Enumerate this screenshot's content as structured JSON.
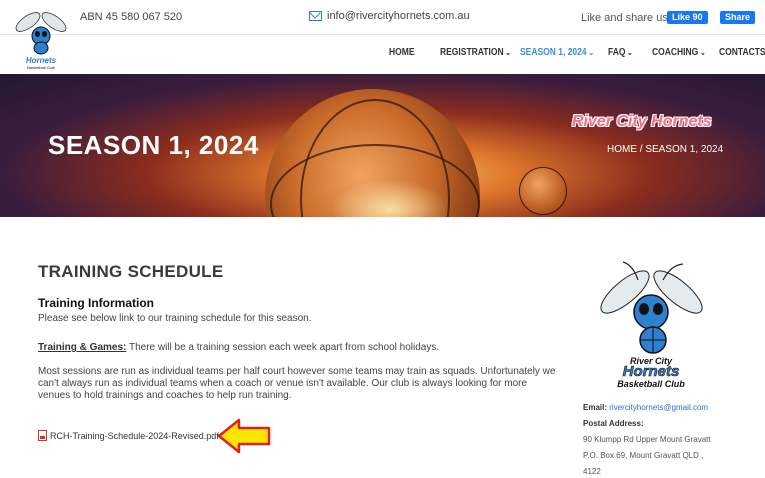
{
  "topbar": {
    "abn": "ABN 45 580 067 520",
    "email": "info@rivercityhornets.com.au",
    "share_text": "Like and share us",
    "fb_like": "Like 90",
    "fb_share": "Share"
  },
  "nav": {
    "items": [
      {
        "label": "HOME",
        "dropdown": false
      },
      {
        "label": "REGISTRATION",
        "dropdown": true
      },
      {
        "label": "SEASON 1, 2024",
        "dropdown": true,
        "active": true
      },
      {
        "label": "FAQ",
        "dropdown": true
      },
      {
        "label": "COACHING",
        "dropdown": true
      },
      {
        "label": "CONTACTS",
        "dropdown": false
      }
    ],
    "accent_color": "#3a8fd9"
  },
  "hero": {
    "title": "SEASON 1, 2024",
    "breadcrumb": "HOME / SEASON 1, 2024",
    "brand": "River City Hornets"
  },
  "main": {
    "section_title": "TRAINING SCHEDULE",
    "sub_title": "Training Information",
    "intro": "Please see below link to our training schedule for this season.",
    "training_label": "Training & Games:",
    "training_text": " There will be a training session each week apart from school holidays.",
    "sessions_text": "Most sessions are run as individual teams per half court however some teams may train as squads. Unfortunately we can't always run as individual teams when a coach or venue isn't available. Our club is always looking for more venues to hold trainings and coaches to help run training.",
    "pdf_link": "RCH-Training-Schedule-2024-Revised.pdf"
  },
  "sidebar": {
    "logo_line1": "River City",
    "logo_line2": "Hornets",
    "logo_line3": "Basketball Club",
    "email_label": "Email:",
    "email": "rivercityhornets@gmail.com",
    "postal_label": "Postal Address:",
    "address_1": "90 Klumpp Rd Upper Mount Gravatt",
    "address_2": "P.O. Box 69, Mount Gravatt QLD ,",
    "address_3": "4122"
  }
}
